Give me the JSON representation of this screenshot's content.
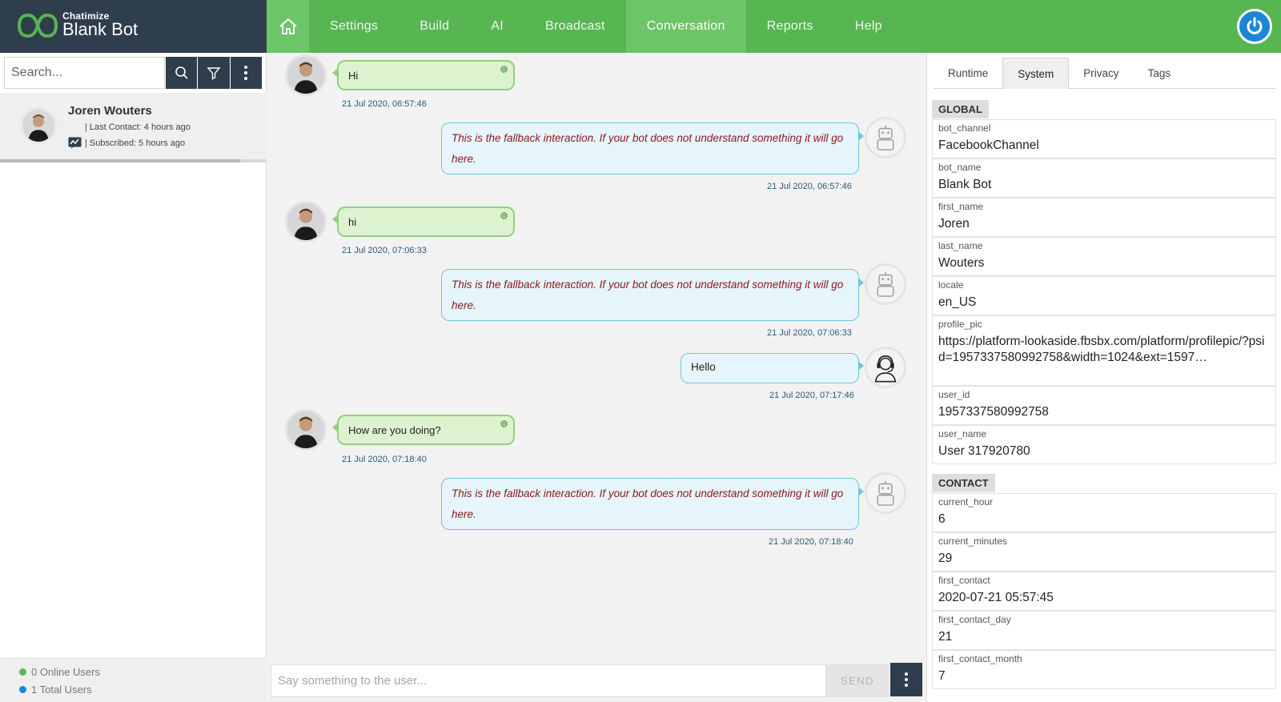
{
  "brand": {
    "small": "Chatimize",
    "name": "Blank Bot"
  },
  "nav": {
    "items": [
      {
        "label": "Settings"
      },
      {
        "label": "Build"
      },
      {
        "label": "AI"
      },
      {
        "label": "Broadcast"
      },
      {
        "label": "Conversation"
      },
      {
        "label": "Reports"
      },
      {
        "label": "Help"
      }
    ],
    "active": "Conversation"
  },
  "sidebar": {
    "search_placeholder": "Search...",
    "contact": {
      "name": "Joren Wouters",
      "last_contact": "| Last Contact: 4 hours ago",
      "subscribed": "| Subscribed: 5 hours ago"
    },
    "footer": {
      "online": "0 Online Users",
      "total": "1 Total Users"
    }
  },
  "colors": {
    "brand_dark": "#2f3e4c",
    "nav_green": "#57b552",
    "online_dot": "#5cb85c",
    "total_dot": "#1c86d6"
  },
  "conversation": {
    "messages": [
      {
        "from": "user",
        "text": "Hi",
        "time": "21 Jul 2020, 06:57:46"
      },
      {
        "from": "bot",
        "text": "This is the fallback interaction. If your bot does not understand something it will go here.",
        "time": "21 Jul 2020, 06:57:46"
      },
      {
        "from": "user",
        "text": "hi",
        "time": "21 Jul 2020, 07:06:33"
      },
      {
        "from": "bot",
        "text": "This is the fallback interaction. If your bot does not understand something it will go here.",
        "time": "21 Jul 2020, 07:06:33"
      },
      {
        "from": "operator",
        "text": "Hello",
        "time": "21 Jul 2020, 07:17:46"
      },
      {
        "from": "user",
        "text": "How are you doing?",
        "time": "21 Jul 2020, 07:18:40"
      },
      {
        "from": "bot",
        "text": "This is the fallback interaction. If your bot does not understand something it will go here.",
        "time": "21 Jul 2020, 07:18:40"
      }
    ],
    "compose_placeholder": "Say something to the user...",
    "send_label": "SEND"
  },
  "details": {
    "tabs": [
      "Runtime",
      "System",
      "Privacy",
      "Tags"
    ],
    "active_tab": "System",
    "global_label": "GLOBAL",
    "global": [
      {
        "key": "bot_channel",
        "value": "FacebookChannel"
      },
      {
        "key": "bot_name",
        "value": "Blank Bot"
      },
      {
        "key": "first_name",
        "value": "Joren"
      },
      {
        "key": "last_name",
        "value": "Wouters"
      },
      {
        "key": "locale",
        "value": "en_US"
      },
      {
        "key": "profile_pic",
        "value": "https://platform-lookaside.fbsbx.com/platform/profilepic/?psid=1957337580992758&width=1024&ext=1597…"
      },
      {
        "key": "user_id",
        "value": "1957337580992758"
      },
      {
        "key": "user_name",
        "value": "User 317920780"
      }
    ],
    "contact_label": "CONTACT",
    "contact": [
      {
        "key": "current_hour",
        "value": "6"
      },
      {
        "key": "current_minutes",
        "value": "29"
      },
      {
        "key": "first_contact",
        "value": "2020-07-21 05:57:45"
      },
      {
        "key": "first_contact_day",
        "value": "21"
      },
      {
        "key": "first_contact_month",
        "value": "7"
      }
    ]
  }
}
